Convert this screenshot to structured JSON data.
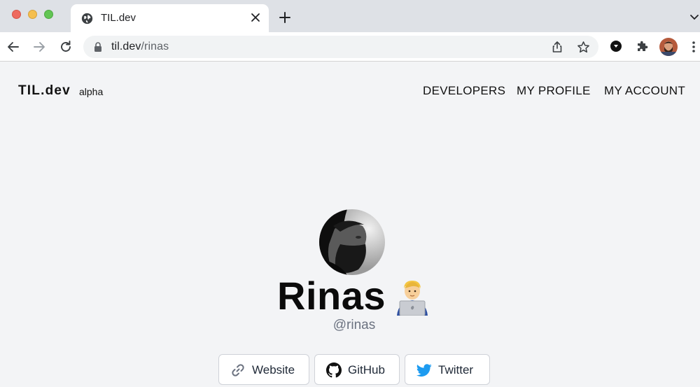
{
  "browser": {
    "tab_title": "TIL.dev",
    "url_host": "til.dev",
    "url_path": "/rinas"
  },
  "site": {
    "brand": "TIL.dev",
    "brand_tag": "alpha",
    "nav": [
      "DEVELOPERS",
      "MY PROFILE",
      "MY ACCOUNT"
    ]
  },
  "profile": {
    "name": "Rinas",
    "handle": "@rinas",
    "emoji": "technologist-emoji",
    "links": [
      {
        "label": "Website",
        "icon": "link-icon"
      },
      {
        "label": "GitHub",
        "icon": "github-icon"
      },
      {
        "label": "Twitter",
        "icon": "twitter-icon"
      }
    ]
  },
  "colors": {
    "page_bg": "#f3f4f6",
    "twitter_blue": "#1d9bf0",
    "handle_gray": "#6b7280"
  }
}
